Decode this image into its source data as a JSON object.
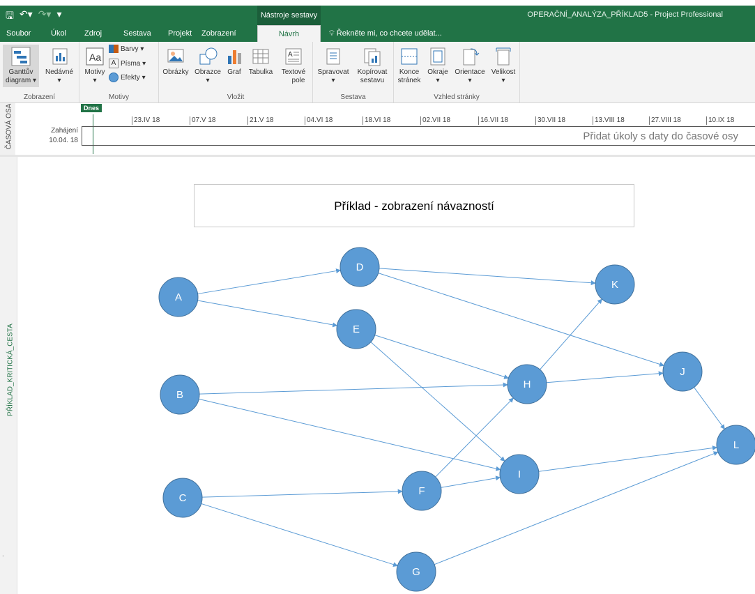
{
  "titlebar": {
    "context_tab": "Nástroje sestavy",
    "window_title": "OPERAČNÍ_ANALÝZA_PŘÍKLAD5 - Project Professional"
  },
  "tabs": [
    {
      "label": "Soubor"
    },
    {
      "label": "Úkol"
    },
    {
      "label": "Zdroj"
    },
    {
      "label": "Sestava"
    },
    {
      "label": "Projekt"
    },
    {
      "label": "Zobrazení"
    },
    {
      "label": "Návrh"
    }
  ],
  "tellme": "Řekněte mi, co chcete udělat...",
  "ribbon": {
    "zobrazeni": {
      "label": "Zobrazení",
      "ganttuv": "Ganttův",
      "diagram": "diagram ▾",
      "nedavne": "Nedávné"
    },
    "motivy": {
      "label": "Motivy",
      "motivy_btn": "Motivy",
      "barvy": "Barvy ▾",
      "pisma": "Písma ▾",
      "efekty": "Efekty ▾"
    },
    "vlozit": {
      "label": "Vložit",
      "obrazky": "Obrázky",
      "obrazce": "Obrazce",
      "graf": "Graf",
      "tabulka": "Tabulka",
      "textove1": "Textové",
      "textove2": "pole"
    },
    "sestava": {
      "label": "Sestava",
      "spravovat": "Spravovat",
      "kopirovat1": "Kopírovat",
      "kopirovat2": "sestavu"
    },
    "vzhled": {
      "label": "Vzhled stránky",
      "konce1": "Konce",
      "konce2": "stránek",
      "okraje": "Okraje",
      "orientace": "Orientace",
      "velikost": "Velikost"
    }
  },
  "timeline": {
    "vertical_label": "ČASOVÁ OSA",
    "today": "Dnes",
    "ticks": [
      "23.IV 18",
      "07.V 18",
      "21.V 18",
      "04.VI 18",
      "18.VI 18",
      "02.VII 18",
      "16.VII 18",
      "30.VII 18",
      "13.VIII 18",
      "27.VIII 18",
      "10.IX 18"
    ],
    "start_label": "Zahájení",
    "start_date": "10.04. 18",
    "hint": "Přidat úkoly s daty do časové osy"
  },
  "report": {
    "vertical_label": "PŘÍKLAD_KRITICKÁ_CESTA",
    "title": "Příklad - zobrazení návazností"
  },
  "network": {
    "node_color": "#5b9bd5",
    "nodes": [
      "A",
      "B",
      "C",
      "D",
      "E",
      "F",
      "G",
      "H",
      "I",
      "J",
      "K",
      "L"
    ],
    "edges": [
      [
        "A",
        "D"
      ],
      [
        "A",
        "E"
      ],
      [
        "D",
        "K"
      ],
      [
        "D",
        "J"
      ],
      [
        "E",
        "H"
      ],
      [
        "E",
        "I"
      ],
      [
        "B",
        "H"
      ],
      [
        "B",
        "I"
      ],
      [
        "C",
        "F"
      ],
      [
        "C",
        "G"
      ],
      [
        "F",
        "H"
      ],
      [
        "F",
        "I"
      ],
      [
        "H",
        "K"
      ],
      [
        "H",
        "J"
      ],
      [
        "I",
        "L"
      ],
      [
        "J",
        "L"
      ],
      [
        "G",
        "L"
      ]
    ]
  },
  "colors": {
    "accent": "#217346",
    "edge": "#5b9bd5"
  }
}
